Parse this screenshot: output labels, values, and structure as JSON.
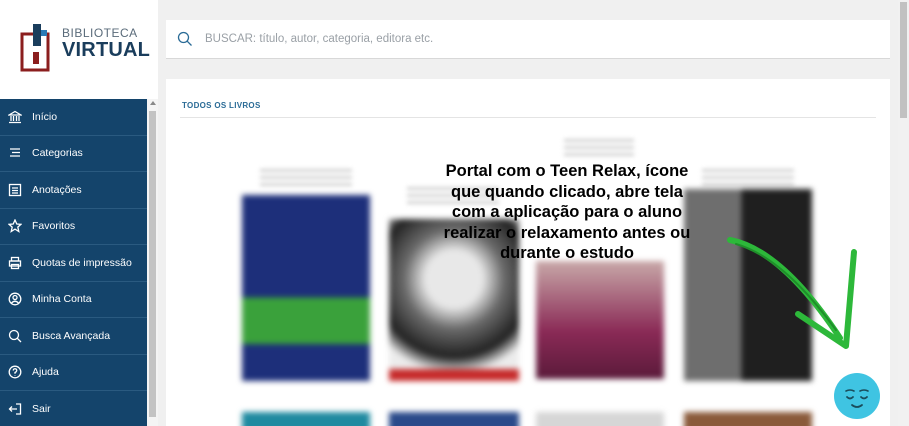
{
  "logo": {
    "top_text": "BIBLIOTECA",
    "bottom_text": "VIRTUAL"
  },
  "sidebar": {
    "items": [
      {
        "label": "Início",
        "icon": "bank-icon"
      },
      {
        "label": "Categorias",
        "icon": "list-icon"
      },
      {
        "label": "Anotações",
        "icon": "notes-icon"
      },
      {
        "label": "Favoritos",
        "icon": "star-icon"
      },
      {
        "label": "Quotas de impressão",
        "icon": "printer-icon"
      },
      {
        "label": "Minha Conta",
        "icon": "user-icon"
      },
      {
        "label": "Busca Avançada",
        "icon": "search-icon"
      },
      {
        "label": "Ajuda",
        "icon": "help-icon"
      },
      {
        "label": "Sair",
        "icon": "logout-icon"
      }
    ]
  },
  "search": {
    "placeholder": "BUSCAR: título, autor, categoria, editora etc.",
    "value": ""
  },
  "main": {
    "section_title": "TODOS OS LIVROS"
  },
  "annotation": {
    "lines": [
      "Portal com o Teen Relax, ícone",
      "que quando clicado, abre tela",
      "com a aplicação para o aluno",
      "realizar o relaxamento antes ou",
      "durante o estudo"
    ]
  },
  "colors": {
    "sidebar_bg": "#14446b",
    "accent": "#2a6b96",
    "teen_relax": "#3fc4e2",
    "arrow": "#2db83a"
  }
}
